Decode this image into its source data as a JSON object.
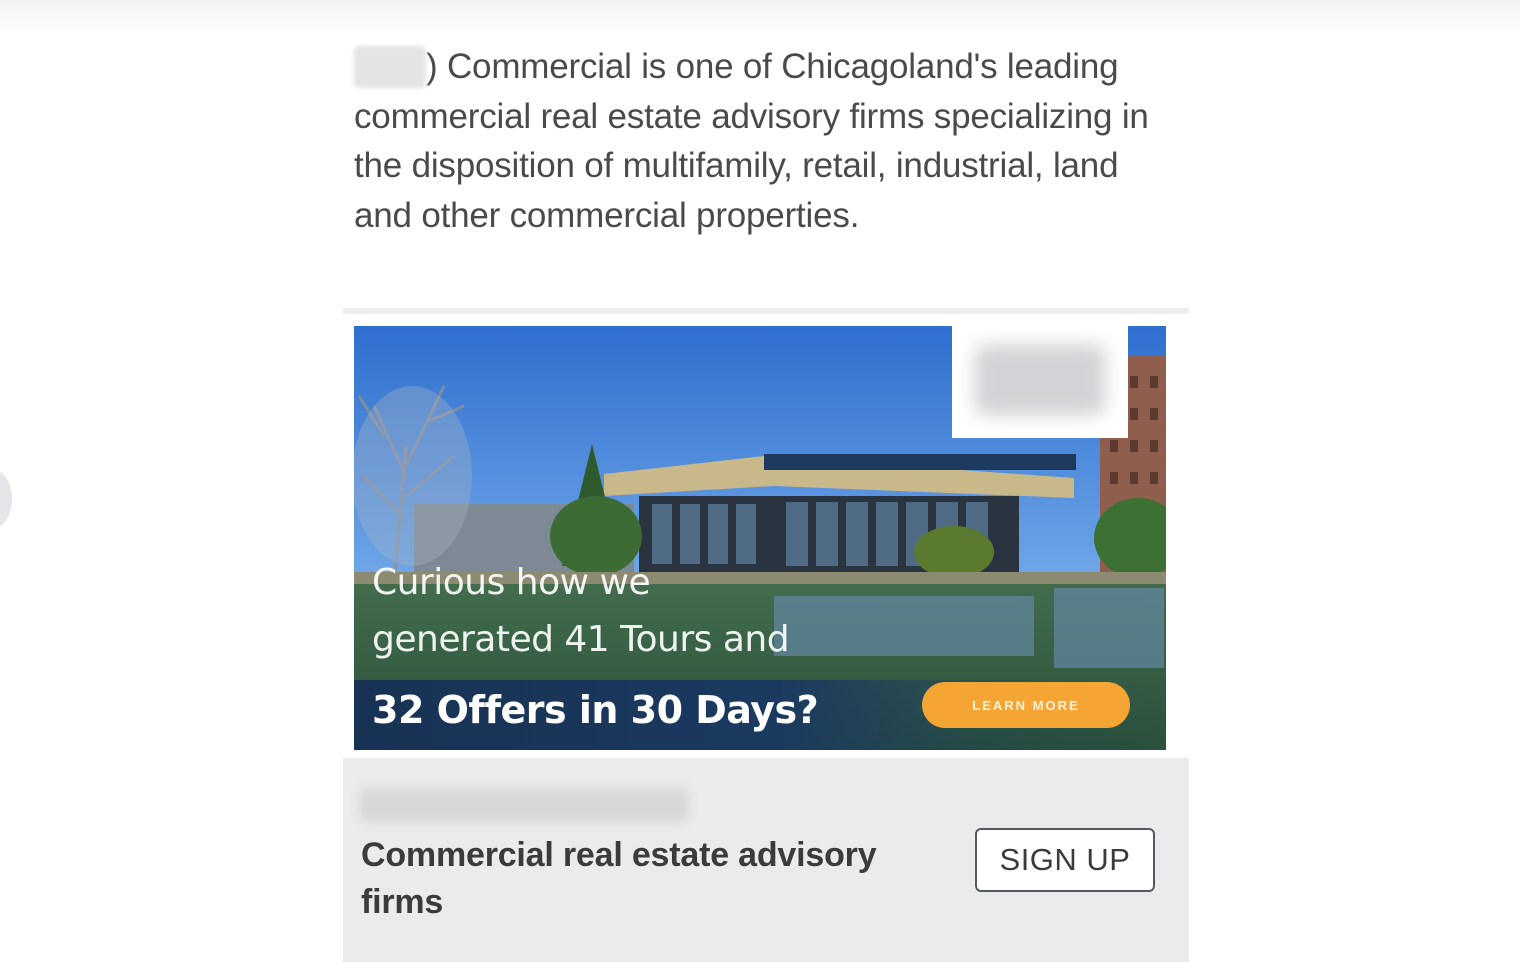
{
  "post": {
    "text": ") Commercial is one of Chicagoland's leading commercial real estate advisory firms specializing in the disposition of multifamily, retail, industrial, land and other commercial properties."
  },
  "ad": {
    "headline_line1": "Curious how we",
    "headline_line2": "generated 41 Tours and",
    "headline_line3": "32 Offers in 30 Days?",
    "cta_image_label": "LEARN MORE"
  },
  "footer": {
    "title_line1": "Commercial real estate advisory",
    "title_line2": "firms",
    "cta_label": "SIGN UP"
  },
  "colors": {
    "cta_orange": "#f4a534",
    "band_navy": "#1b3a60",
    "footer_bg": "#eaebed",
    "text_gray": "#4a4a4a"
  }
}
